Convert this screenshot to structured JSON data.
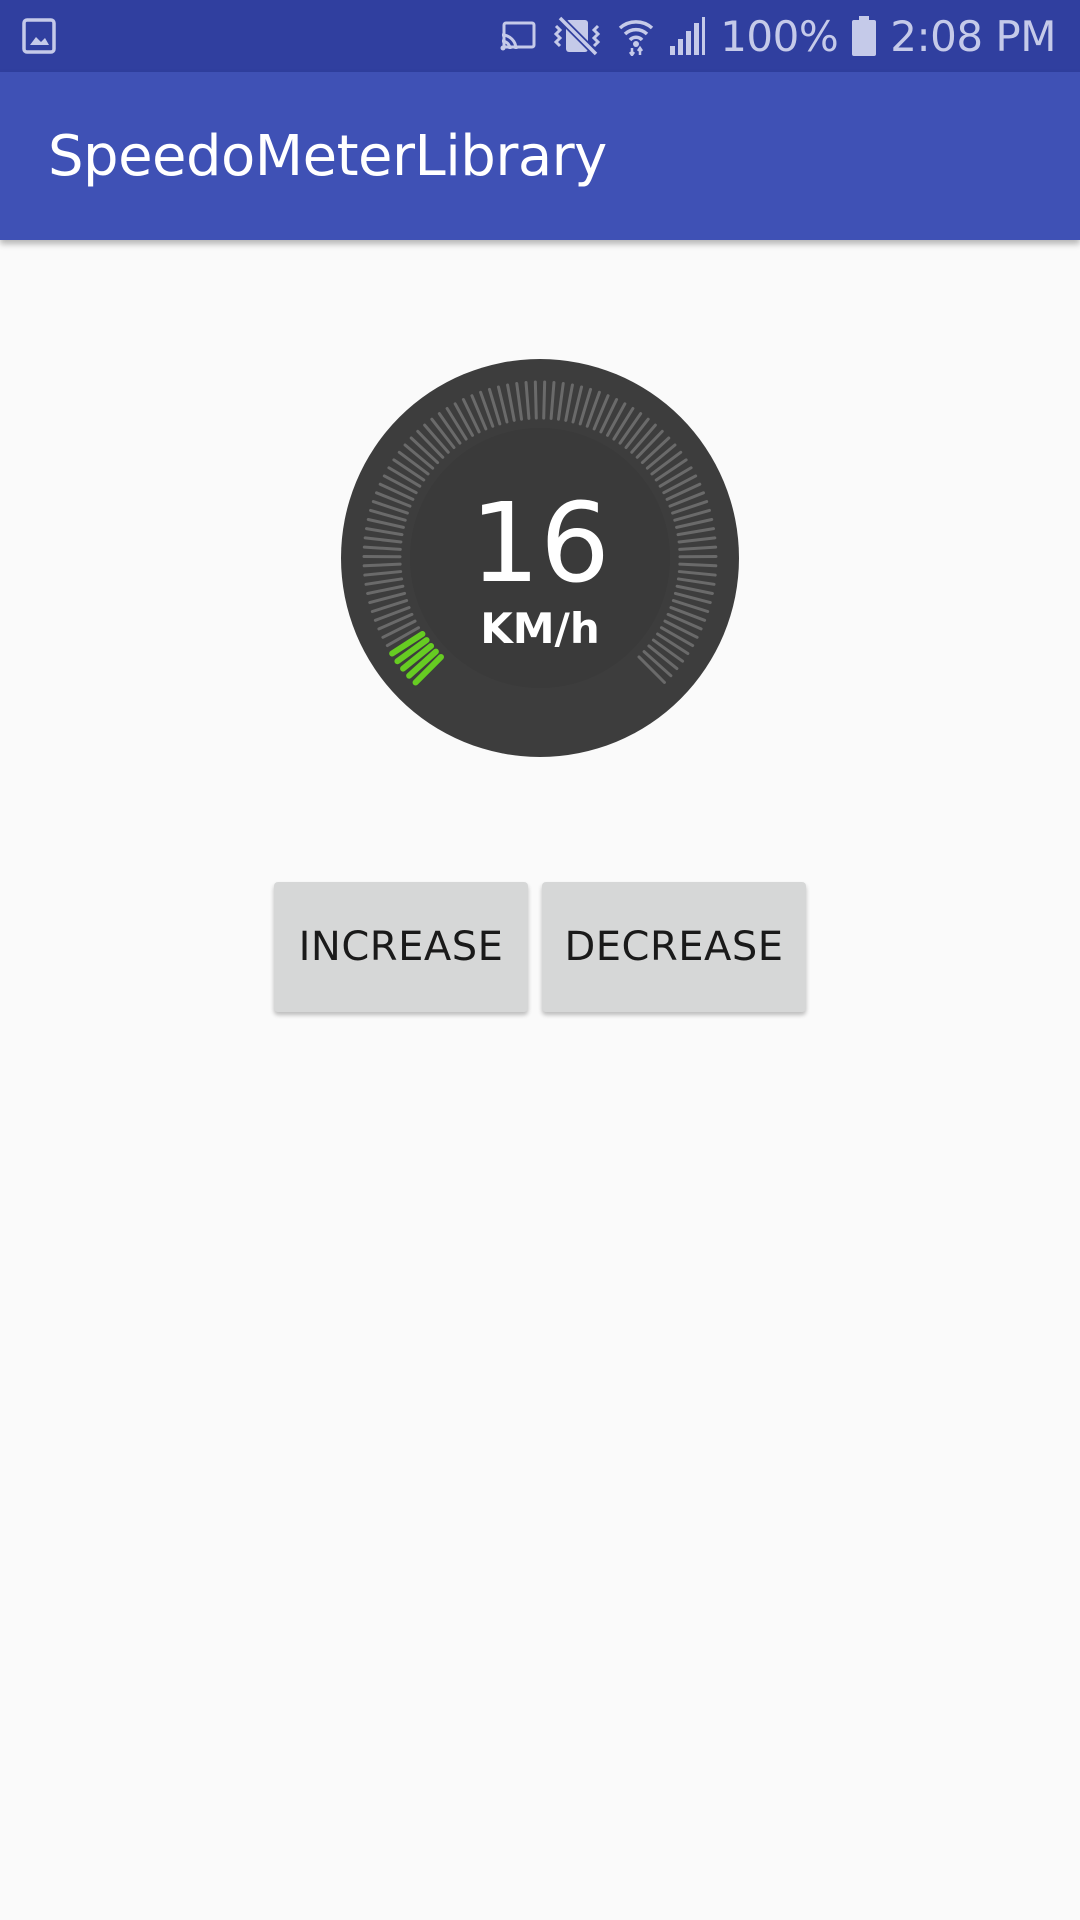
{
  "status_bar": {
    "battery": "100%",
    "time": "2:08 PM",
    "icons": [
      "gallery-icon",
      "cast-icon",
      "vibrate-icon",
      "wifi-icon",
      "signal-icon",
      "battery-icon"
    ]
  },
  "app_bar": {
    "title": "SpeedoMeterLibrary"
  },
  "speedometer": {
    "value": "16",
    "unit": "KM/h",
    "active_fraction": 0.06,
    "colors": {
      "dial": "#3d3d3d",
      "tick": "#6a6a6a",
      "active_tick": "#66cc22"
    }
  },
  "buttons": {
    "increase": "INCREASE",
    "decrease": "DECREASE"
  },
  "colors": {
    "status_bar": "#303f9f",
    "app_bar": "#3f51b5",
    "background": "#fafafa",
    "button": "#d6d7d7"
  }
}
